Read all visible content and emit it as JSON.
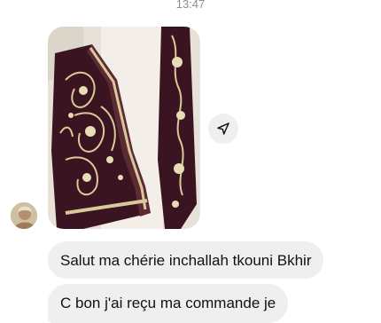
{
  "status": {
    "time": "13:47"
  },
  "thread": {
    "attachment": {
      "subject": "embroidered-velvet-jacket-photo"
    },
    "share_icon": "send-arrow-icon",
    "avatar": "contact-avatar",
    "messages": [
      {
        "text": "Salut ma chérie inchallah tkouni Bkhir"
      },
      {
        "text": "C bon j'ai reçu ma commande je"
      }
    ]
  },
  "colors": {
    "bubble": "#efefef",
    "velvet": "#3a1420",
    "embroidery": "#d9c99a"
  }
}
